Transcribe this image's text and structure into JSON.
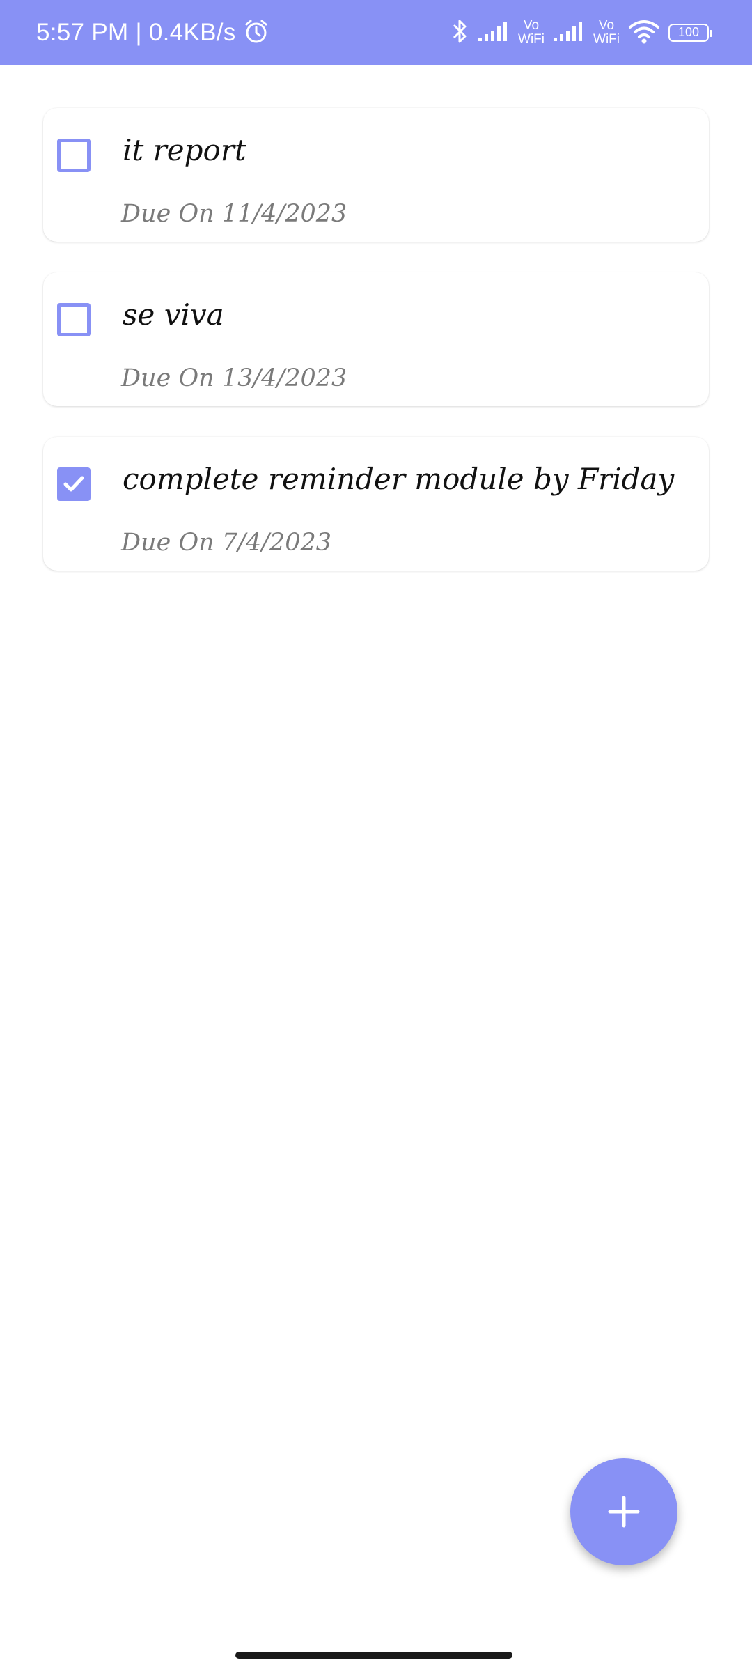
{
  "status_bar": {
    "time_speed": "5:57 PM | 0.4KB/s",
    "vowifi_top": "Vo",
    "vowifi_bottom": "WiFi",
    "battery": "100",
    "icons": [
      "alarm-icon",
      "bluetooth-icon",
      "signal-icon",
      "wifi-icon",
      "battery-icon"
    ]
  },
  "tasks": [
    {
      "title": "it report",
      "due": "Due On 11/4/2023",
      "completed": false
    },
    {
      "title": "se viva",
      "due": "Due On 13/4/2023",
      "completed": false
    },
    {
      "title": "complete reminder module by Friday",
      "due": "Due On 7/4/2023",
      "completed": true
    }
  ],
  "fab": {
    "icon": "plus-icon"
  },
  "colors": {
    "accent": "#8891f5",
    "title_text": "#111111",
    "due_text": "#7a7a7a",
    "background": "#ffffff"
  }
}
